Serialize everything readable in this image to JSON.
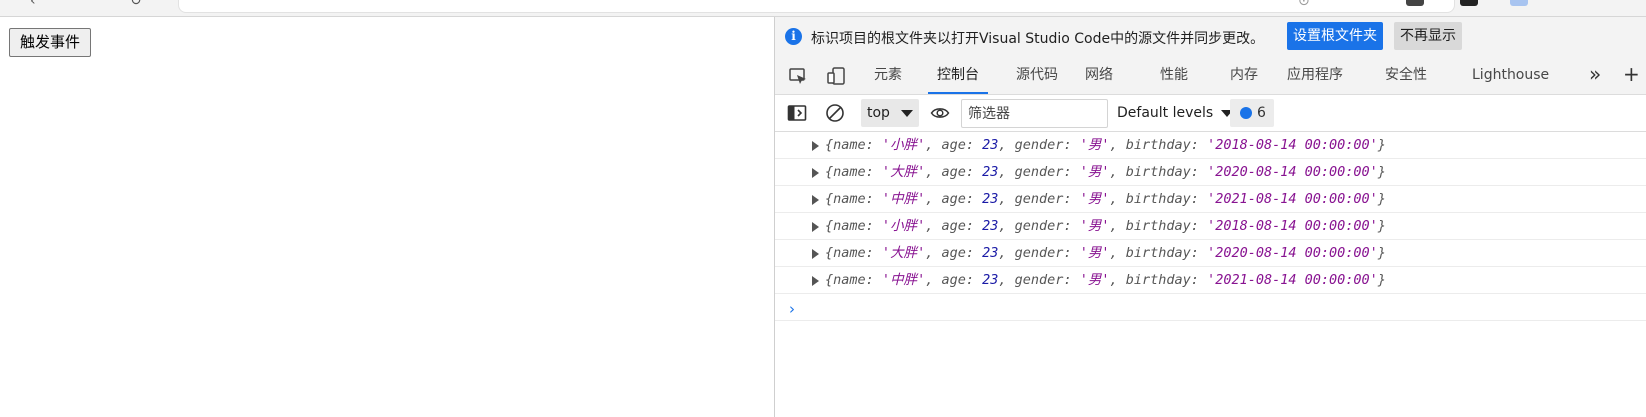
{
  "page": {
    "trigger_button": "触发事件"
  },
  "infobar": {
    "message": "标识项目的根文件夹以打开Visual Studio Code中的源文件并同步更改。",
    "set_root_label": "设置根文件夹",
    "dismiss_label": "不再显示",
    "info_icon": "i"
  },
  "tabs": [
    {
      "label": "元素"
    },
    {
      "label": "控制台"
    },
    {
      "label": "源代码"
    },
    {
      "label": "网络"
    },
    {
      "label": "性能"
    },
    {
      "label": "内存"
    },
    {
      "label": "应用程序"
    },
    {
      "label": "安全性"
    },
    {
      "label": "Lighthouse"
    }
  ],
  "toolbar": {
    "context": "top",
    "filter_placeholder": "筛选器",
    "levels": "Default levels",
    "issues_count": "6"
  },
  "console": {
    "logs": [
      {
        "name": "小胖",
        "age": "23",
        "gender": "男",
        "birthday": "2018-08-14 00:00:00"
      },
      {
        "name": "大胖",
        "age": "23",
        "gender": "男",
        "birthday": "2020-08-14 00:00:00"
      },
      {
        "name": "中胖",
        "age": "23",
        "gender": "男",
        "birthday": "2021-08-14 00:00:00"
      },
      {
        "name": "小胖",
        "age": "23",
        "gender": "男",
        "birthday": "2018-08-14 00:00:00"
      },
      {
        "name": "大胖",
        "age": "23",
        "gender": "男",
        "birthday": "2020-08-14 00:00:00"
      },
      {
        "name": "中胖",
        "age": "23",
        "gender": "男",
        "birthday": "2021-08-14 00:00:00"
      }
    ],
    "prompt_symbol": "›",
    "syntax": {
      "open": "{",
      "close": "}",
      "key_name": "name",
      "key_age": "age",
      "key_gender": "gender",
      "key_birthday": "birthday",
      "sep": ", ",
      "colon": ": ",
      "quote": "'"
    }
  },
  "icons": {
    "more_tabs": "»",
    "add_tab": "+"
  },
  "colors": {
    "accent": "#1a73e8",
    "string": "#881391",
    "number": "#1a1aa6"
  }
}
